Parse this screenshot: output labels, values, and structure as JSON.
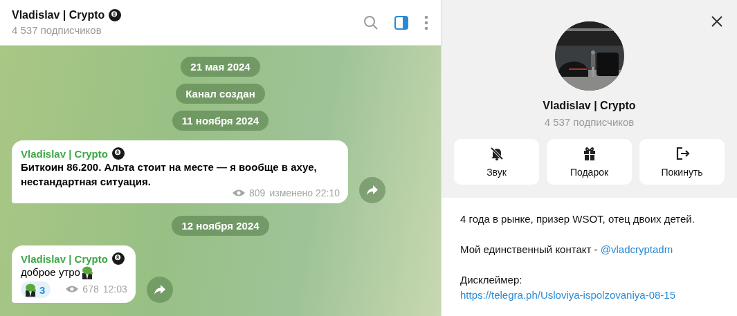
{
  "header": {
    "title": "Vladislav | Crypto",
    "subtitle": "4 537 подписчиков",
    "info_panel_open": true
  },
  "messages": [
    {
      "kind": "date",
      "text": "21 мая 2024"
    },
    {
      "kind": "service",
      "text": "Канал создан"
    },
    {
      "kind": "date",
      "text": "11 ноября 2024"
    },
    {
      "kind": "post",
      "author": "Vladislav | Crypto",
      "text": "Биткоин 86.200. Альта стоит на месте — я вообще в ахуе, нестандартная ситуация.",
      "bold": true,
      "views": "809",
      "time": "изменено 22:10"
    },
    {
      "kind": "date",
      "text": "12 ноября 2024"
    },
    {
      "kind": "post",
      "author": "Vladislav | Crypto",
      "text": "доброе утро",
      "bold": false,
      "sticker": true,
      "reaction_count": "3",
      "views": "678",
      "time": "12:03"
    }
  ],
  "profile": {
    "name": "Vladislav | Crypto",
    "subtitle": "4 537 подписчиков",
    "actions": [
      {
        "kind": "mute",
        "label": "Звук"
      },
      {
        "kind": "gift",
        "label": "Подарок"
      },
      {
        "kind": "leave",
        "label": "Покинуть"
      }
    ],
    "about": [
      {
        "text": "4 года в рынке, призер WSOT, отец двоих детей."
      },
      {
        "text": "Мой единственный контакт - ",
        "link": "@vladcryptadm"
      },
      {
        "text": "Дисклеймер: ",
        "link": "https://telegra.ph/Usloviya-ispolzovaniya-08-15"
      }
    ]
  }
}
